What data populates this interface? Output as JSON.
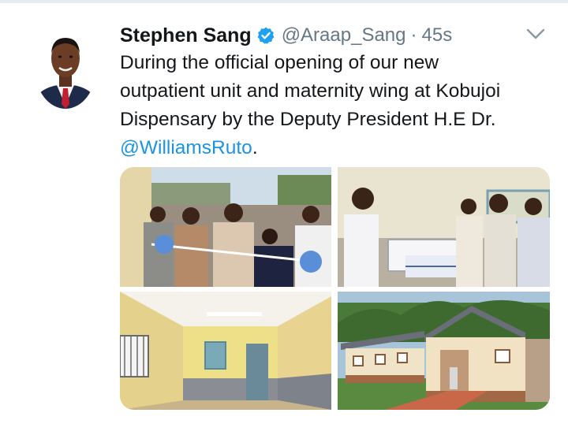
{
  "tweet": {
    "author": {
      "name": "Stephen Sang",
      "handle": "@Araap_Sang",
      "separator": "·",
      "timestamp": "45s",
      "verified": true
    },
    "text": {
      "line1": "During the official opening of our new",
      "line2": "outpatient unit and maternity wing at Kobujoi",
      "line3": "Dispensary by the Deputy President H.E Dr.",
      "mention": "@WilliamsRuto",
      "suffix": "."
    },
    "media": {
      "photos": [
        {
          "subject": "ribbon-cutting-ceremony"
        },
        {
          "subject": "maternity-ward-beds"
        },
        {
          "subject": "empty-room-interior"
        },
        {
          "subject": "dispensary-building-exterior"
        }
      ]
    }
  },
  "icons": {
    "verified": "verified-badge-icon",
    "menu": "chevron-down-icon"
  },
  "colors": {
    "text": "#14171a",
    "secondary": "#657786",
    "link": "#1b95e0",
    "verified": "#1da1f2"
  }
}
